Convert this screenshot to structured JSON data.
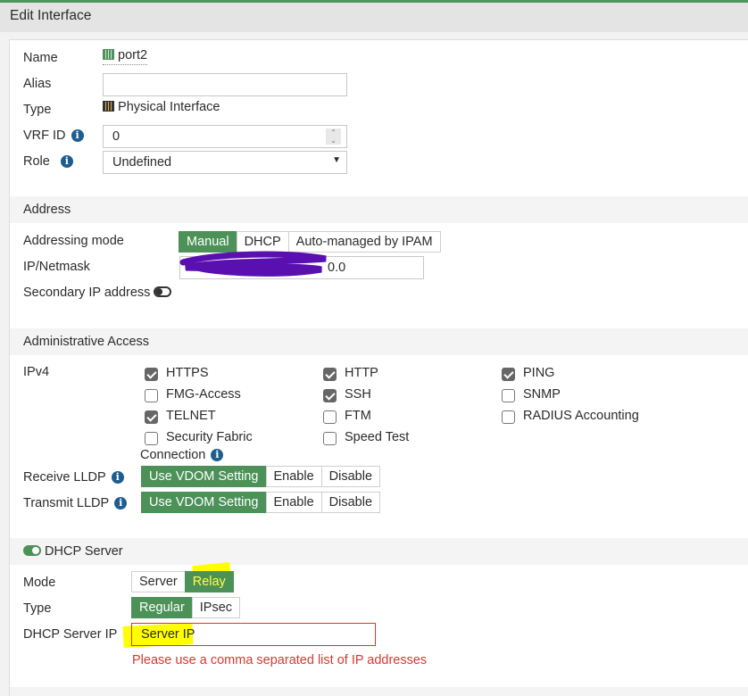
{
  "header": {
    "title": "Edit Interface"
  },
  "general": {
    "name_label": "Name",
    "name_value": "port2",
    "alias_label": "Alias",
    "alias_value": "",
    "type_label": "Type",
    "type_value": "Physical Interface",
    "vrf_label": "VRF ID",
    "vrf_value": "0",
    "role_label": "Role",
    "role_value": "Undefined"
  },
  "address": {
    "title": "Address",
    "mode_label": "Addressing mode",
    "modes": [
      "Manual",
      "DHCP",
      "Auto-managed by IPAM"
    ],
    "ip_label": "IP/Netmask",
    "ip_visible": "0.0",
    "secondary_label": "Secondary IP address"
  },
  "admin": {
    "title": "Administrative Access",
    "ipv4_label": "IPv4",
    "options": [
      {
        "label": "HTTPS",
        "checked": true
      },
      {
        "label": "HTTP",
        "checked": true
      },
      {
        "label": "PING",
        "checked": true
      },
      {
        "label": "FMG-Access",
        "checked": false
      },
      {
        "label": "SSH",
        "checked": true
      },
      {
        "label": "SNMP",
        "checked": false
      },
      {
        "label": "TELNET",
        "checked": true
      },
      {
        "label": "FTM",
        "checked": false
      },
      {
        "label": "RADIUS Accounting",
        "checked": false
      },
      {
        "label": "Security Fabric",
        "checked": false
      },
      {
        "label": "Speed Test",
        "checked": false
      }
    ],
    "fabric_cont": "Connection",
    "rx_label": "Receive LLDP",
    "tx_label": "Transmit LLDP",
    "lldp_options": [
      "Use VDOM Setting",
      "Enable",
      "Disable"
    ]
  },
  "dhcp": {
    "title": "DHCP Server",
    "mode_label": "Mode",
    "modes": [
      "Server",
      "Relay"
    ],
    "type_label": "Type",
    "types": [
      "Regular",
      "IPsec"
    ],
    "ip_label": "DHCP Server IP",
    "ip_value": "Server IP",
    "error": "Please use a comma separated list of IP addresses"
  },
  "colors": {
    "accent": "#4c9158",
    "error": "#d23a2f",
    "highlight": "#ffff00"
  }
}
